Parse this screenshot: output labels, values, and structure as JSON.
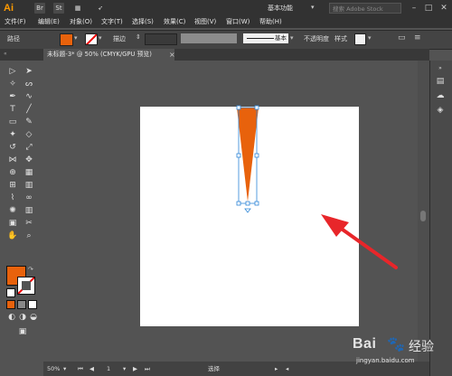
{
  "app": {
    "logo": "Ai",
    "bridge_label": "Br",
    "stock_label": "St",
    "workspace": "基本功能",
    "search_placeholder": "搜索 Adobe Stock"
  },
  "menu": [
    "文件(F)",
    "编辑(E)",
    "对象(O)",
    "文字(T)",
    "选择(S)",
    "效果(C)",
    "视图(V)",
    "窗口(W)",
    "帮助(H)"
  ],
  "control": {
    "object_type": "路径",
    "stroke_label": "描边",
    "profile": "基本",
    "opacity_label": "不透明度",
    "style_label": "样式"
  },
  "colors": {
    "fill": "#e8620c",
    "accent": "#ff9a00",
    "arrow": "#e8262a",
    "selection": "#2e86d8"
  },
  "doc_tab": {
    "title": "未标题-3* @ 50% (CMYK/GPU 预览)",
    "close": "×"
  },
  "status": {
    "zoom": "50%",
    "page": "1",
    "tool_name": "选择"
  },
  "watermark": {
    "brand": "Bai",
    "brand_suffix": "经验",
    "url": "jingyan.baidu.com"
  },
  "tool_icons": [
    "selection-tool-icon",
    "direct-selection-tool-icon",
    "magic-wand-tool-icon",
    "lasso-tool-icon",
    "pen-tool-icon",
    "curvature-tool-icon",
    "type-tool-icon",
    "line-tool-icon",
    "rectangle-tool-icon",
    "paintbrush-tool-icon",
    "shaper-tool-icon",
    "eraser-tool-icon",
    "rotate-tool-icon",
    "scale-tool-icon",
    "width-tool-icon",
    "puppet-warp-tool-icon",
    "shape-builder-tool-icon",
    "perspective-grid-tool-icon",
    "mesh-tool-icon",
    "gradient-tool-icon",
    "eyedropper-tool-icon",
    "blend-tool-icon",
    "symbol-sprayer-tool-icon",
    "column-graph-tool-icon",
    "artboard-tool-icon",
    "slice-tool-icon",
    "hand-tool-icon",
    "zoom-tool-icon"
  ]
}
